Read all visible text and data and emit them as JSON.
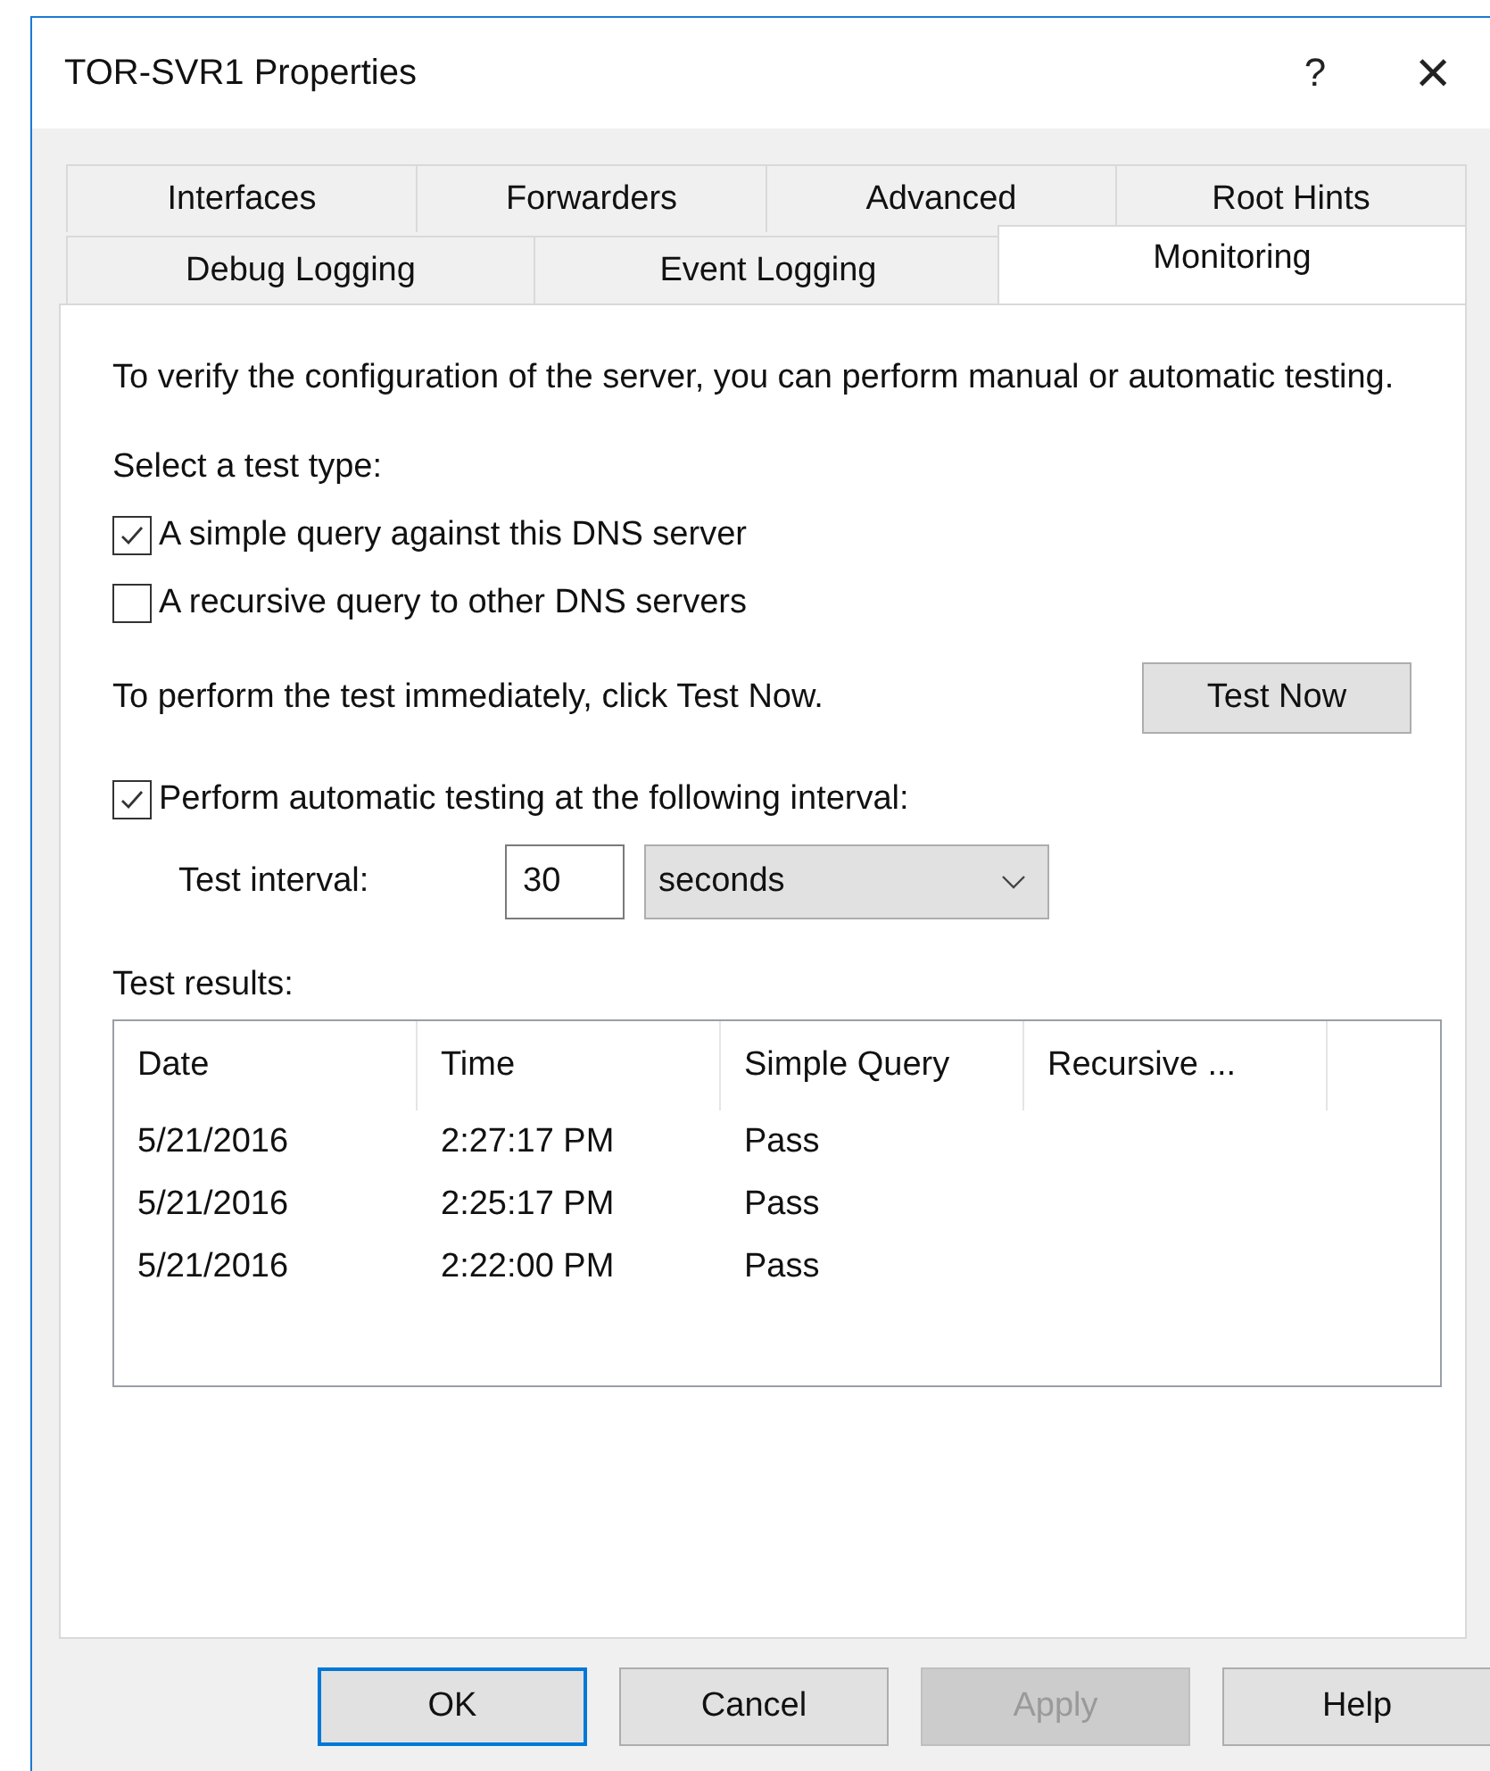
{
  "window": {
    "title": "TOR-SVR1 Properties",
    "help_glyph": "?",
    "close_glyph": "×"
  },
  "tab_rows": [
    [
      {
        "label": "Interfaces",
        "selected": false
      },
      {
        "label": "Forwarders",
        "selected": false
      },
      {
        "label": "Advanced",
        "selected": false
      },
      {
        "label": "Root Hints",
        "selected": false
      }
    ],
    [
      {
        "label": "Debug Logging",
        "selected": false
      },
      {
        "label": "Event Logging",
        "selected": false
      },
      {
        "label": "Monitoring",
        "selected": true
      }
    ]
  ],
  "intro": "To verify the configuration of the server, you can perform manual or automatic testing.",
  "test_type_label": "Select a test type:",
  "test_types": [
    {
      "label": "A simple query against this DNS server",
      "checked": true
    },
    {
      "label": "A recursive query to other DNS servers",
      "checked": false
    }
  ],
  "test_now": {
    "text": "To perform the test immediately, click Test Now.",
    "button": "Test Now"
  },
  "automatic": {
    "label": "Perform automatic testing at the following interval:",
    "checked": true
  },
  "interval": {
    "label": "Test interval:",
    "value": "30",
    "unit": "seconds"
  },
  "results": {
    "label": "Test results:",
    "columns": [
      "Date",
      "Time",
      "Simple Query",
      "Recursive ..."
    ],
    "rows": [
      [
        "5/21/2016",
        "2:27:17 PM",
        "Pass"
      ],
      [
        "5/21/2016",
        "2:25:17 PM",
        "Pass"
      ],
      [
        "5/21/2016",
        "2:22:00 PM",
        "Pass"
      ]
    ]
  },
  "buttons": [
    {
      "label": "OK",
      "default": true,
      "disabled": false
    },
    {
      "label": "Cancel",
      "default": false,
      "disabled": false
    },
    {
      "label": "Apply",
      "default": false,
      "disabled": true
    },
    {
      "label": "Help",
      "default": false,
      "disabled": false
    }
  ]
}
